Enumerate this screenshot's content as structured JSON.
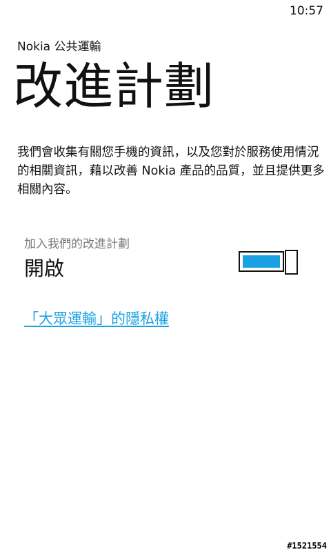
{
  "status_bar": {
    "time": "10:57"
  },
  "header": {
    "app_name": "Nokia 公共運輸",
    "page_title": "改進計劃"
  },
  "main": {
    "description": "我們會收集有關您手機的資訊，以及您對於服務使用情況的相關資訊，藉以改善 Nokia 產品的品質，並且提供更多相關內容。",
    "toggle": {
      "label": "加入我們的改進計劃",
      "state_text": "開啟",
      "is_on": true,
      "accent_color": "#1ba1e2"
    },
    "privacy_link": "「大眾運輸」的隱私權"
  },
  "watermark": "#1521554"
}
